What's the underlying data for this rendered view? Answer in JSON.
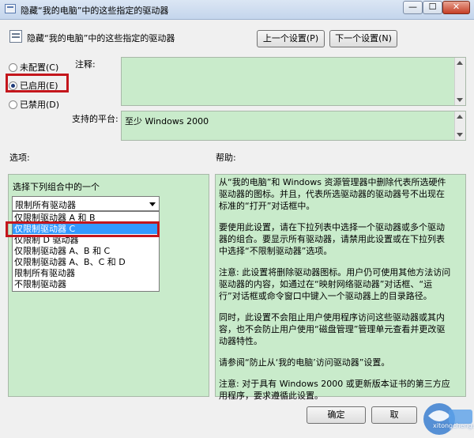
{
  "window": {
    "title": "隐藏“我的电脑”中的这些指定的驱动器",
    "min_label": "—",
    "max_label": "☐",
    "close_label": "✕"
  },
  "header": {
    "policy_title": "隐藏“我的电脑”中的这些指定的驱动器",
    "prev_setting": "上一个设置(P)",
    "next_setting": "下一个设置(N)"
  },
  "state": {
    "not_configured": "未配置(C)",
    "enabled": "已启用(E)",
    "disabled": "已禁用(D)",
    "selected": "enabled"
  },
  "fields": {
    "comment_label": "注释:",
    "platform_label": "支持的平台:",
    "platform_value": "至少 Windows 2000"
  },
  "sections": {
    "options_label": "选项:",
    "help_label": "帮助:"
  },
  "options": {
    "prompt": "选择下列组合中的一个",
    "combo_value": "限制所有驱动器",
    "items": [
      "仅限制驱动器 A 和 B",
      "仅限制驱动器 C",
      "仅限制 D 驱动器",
      "仅限制驱动器 A、B 和 C",
      "仅限制驱动器 A、B、C 和 D",
      "限制所有驱动器",
      "不限制驱动器"
    ],
    "highlighted_index": 1
  },
  "help": {
    "paragraphs": [
      "从“我的电脑”和 Windows 资源管理器中删除代表所选硬件驱动器的图标。并且，代表所选驱动器的驱动器号不出现在标准的“打开”对话框中。",
      "要使用此设置，请在下拉列表中选择一个驱动器或多个驱动器的组合。要显示所有驱动器，请禁用此设置或在下拉列表中选择“不限制驱动器”选项。",
      "注意: 此设置将删除驱动器图标。用户仍可使用其他方法访问驱动器的内容，如通过在“映射网络驱动器”对话框、“运行”对话框或命令窗口中键入一个驱动器上的目录路径。",
      "同时，此设置不会阻止用户使用程序访问这些驱动器或其内容，也不会防止用户使用“磁盘管理”管理单元查看并更改驱动器特性。",
      "请参阅“防止从‘我的电脑’访问驱动器”设置。",
      "注意: 对于具有 Windows 2000 或更新版本证书的第三方应用程序，要求遵循此设置。"
    ]
  },
  "footer": {
    "ok_label": "确定",
    "cancel_label": "取"
  },
  "watermark": {
    "text": "xitongcheng.cc"
  },
  "colors": {
    "panel_green": "#c9ebcb",
    "highlight_blue": "#3399ff",
    "annotation_red": "#c4161c"
  }
}
